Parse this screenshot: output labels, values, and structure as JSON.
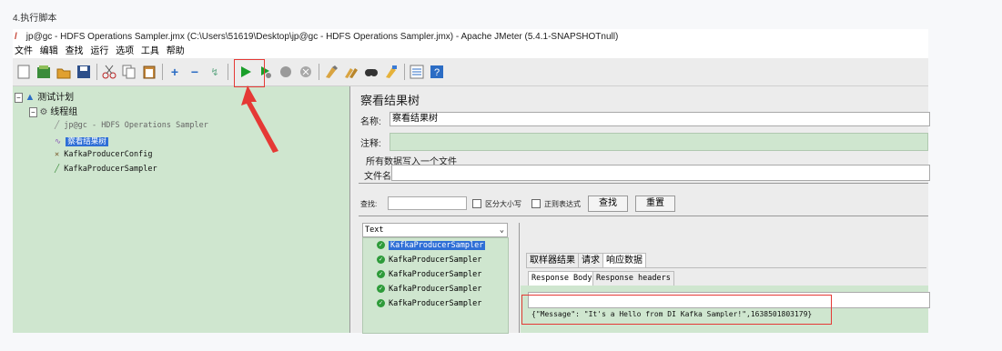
{
  "caption": "4.执行脚本",
  "window": {
    "title": "jp@gc - HDFS Operations Sampler.jmx (C:\\Users\\51619\\Desktop\\jp@gc - HDFS Operations Sampler.jmx) - Apache JMeter (5.4.1-SNAPSHOTnull)"
  },
  "menu": [
    "文件",
    "编辑",
    "查找",
    "运行",
    "选项",
    "工具",
    "帮助"
  ],
  "tree": {
    "test_plan": "测试计划",
    "thread_group": "线程组",
    "items": [
      "jp@gc - HDFS Operations Sampler",
      "察看结果树",
      "KafkaProducerConfig",
      "KafkaProducerSampler"
    ]
  },
  "panel": {
    "heading": "察看结果树",
    "name_label": "名称:",
    "name_value": "察看结果树",
    "comment_label": "注释:",
    "file_section": "所有数据写入一个文件",
    "file_label": "文件名",
    "search_label": "查找:",
    "case_label": "区分大小写",
    "regex_label": "正则表达式",
    "find_button": "查找",
    "reset_button": "重置",
    "renderer": "Text",
    "results": [
      "KafkaProducerSampler",
      "KafkaProducerSampler",
      "KafkaProducerSampler",
      "KafkaProducerSampler",
      "KafkaProducerSampler"
    ],
    "tabs": [
      "取样器结果",
      "请求",
      "响应数据"
    ],
    "subtabs": [
      "Response Body",
      "Response headers"
    ],
    "response": "{\"Message\": \"It's a Hello from DI Kafka Sampler!\",1638501803179}"
  },
  "colors": {
    "highlight": "#e53935",
    "tree_bg": "#cfe6cf",
    "selection": "#2f6fd6"
  }
}
